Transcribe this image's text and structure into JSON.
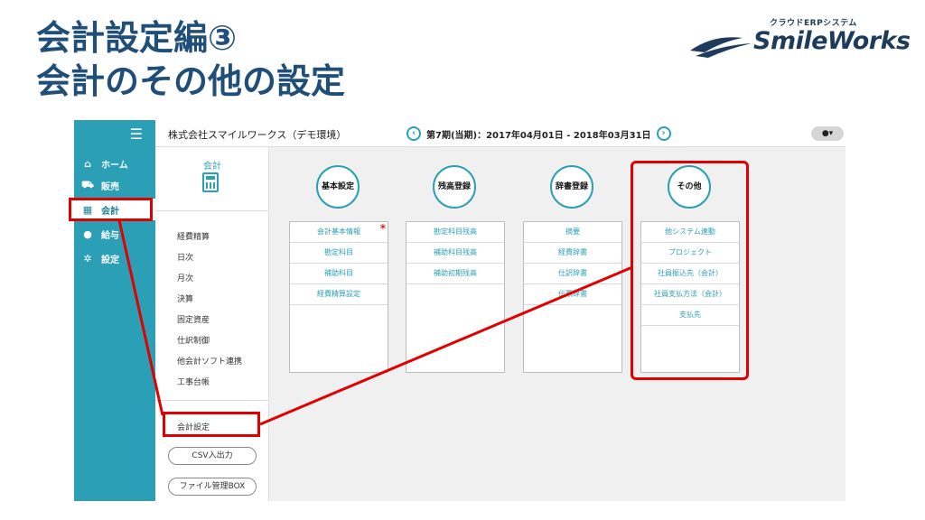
{
  "slide": {
    "title_line1": "会計設定編③",
    "title_line2": "会計のその他の設定"
  },
  "logo": {
    "subtitle": "クラウドERPシステム",
    "name": "SmileWorks"
  },
  "app": {
    "sidebar": {
      "menu_icon": "hamburger-icon",
      "items": [
        {
          "label": "ホーム",
          "icon": "home-icon"
        },
        {
          "label": "販売",
          "icon": "cart-icon"
        },
        {
          "label": "会計",
          "icon": "calculator-icon"
        },
        {
          "label": "給与",
          "icon": "money-bag-icon"
        },
        {
          "label": "設定",
          "icon": "gear-icon"
        }
      ]
    },
    "topbar": {
      "company": "株式会社スマイルワークス（デモ環境）",
      "period": "第7期(当期)：2017年04月01日 - 2018年03月31日",
      "prev_icon": "chevron-left-icon",
      "next_icon": "chevron-right-icon",
      "user_icon": "user-icon"
    },
    "subnav": {
      "title": "会計",
      "items": [
        "経費精算",
        "日次",
        "月次",
        "決算",
        "固定資産",
        "仕訳制御",
        "他会計ソフト連携",
        "工事台帳"
      ],
      "settings": "会計設定",
      "csv": "CSV入出力",
      "filebox": "ファイル管理BOX"
    },
    "categories": [
      {
        "name": "基本設定",
        "items": [
          "会計基本情報",
          "勘定科目",
          "補助科目",
          "経費精算設定"
        ]
      },
      {
        "name": "残高登録",
        "items": [
          "勘定科目残高",
          "補助科目残高",
          "補助初期残高"
        ]
      },
      {
        "name": "辞書登録",
        "items": [
          "摘要",
          "経費辞書",
          "仕訳辞書",
          "伝票辞書"
        ]
      },
      {
        "name": "その他",
        "items": [
          "他システム連動",
          "プロジェクト",
          "社員振込先（会計）",
          "社員支払方法（会計）",
          "支払先"
        ]
      }
    ]
  },
  "colors": {
    "title": "#1f4e79",
    "accent": "#2a9fb6",
    "highlight": "#e00000"
  }
}
